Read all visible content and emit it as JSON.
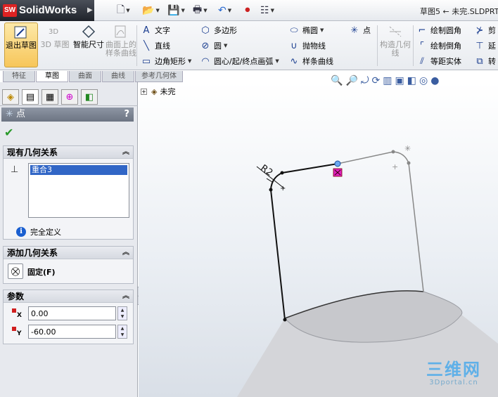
{
  "app": {
    "logo_text": "SolidWorks",
    "logo_badge": "SW",
    "doc_title": "草图5 ← 未完.SLDPRT"
  },
  "ribbon": {
    "exit_sketch": "退出草图",
    "sketch3d": "3D 草图",
    "smart_dim": "智能尺寸",
    "surface_spline": "曲面上的样条曲线",
    "text": "文字",
    "line": "直线",
    "corner_rect": "边角矩形",
    "polygon": "多边形",
    "circle": "圆",
    "arc": "圆心/起/终点画弧",
    "ellipse": "椭圆",
    "parabola": "抛物线",
    "spline": "样条曲线",
    "point": "点",
    "construction": "构造几何线",
    "fillet": "绘制圆角",
    "chamfer": "绘制倒角",
    "offset": "等距实体",
    "trim": "剪",
    "extend": "延",
    "convert": "转"
  },
  "tabs": [
    {
      "label": "特征",
      "active": false
    },
    {
      "label": "草图",
      "active": true
    },
    {
      "label": "曲面",
      "active": false
    },
    {
      "label": "曲线",
      "active": false
    },
    {
      "label": "参考几何体",
      "active": false
    }
  ],
  "property_manager": {
    "title": "点",
    "help": "?",
    "ok_icon": "check-icon",
    "existing_relations": {
      "title": "现有几何关系",
      "items": [
        "重合3"
      ],
      "status": "完全定义"
    },
    "add_relations": {
      "title": "添加几何关系",
      "fix_label": "固定(F)"
    },
    "parameters": {
      "title": "参数",
      "x_label": "X",
      "x_value": "0.00",
      "y_label": "Y",
      "y_value": "-60.00"
    }
  },
  "tree": {
    "root": "未完"
  },
  "canvas": {
    "dimension_label": "R2"
  },
  "watermark": {
    "cn": "三维网",
    "en": "3Dportal.cn"
  }
}
